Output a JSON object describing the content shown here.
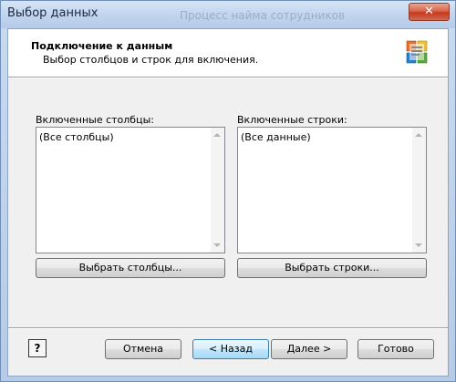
{
  "window": {
    "title": "Выбор данных",
    "background_title": "Процесс найма сотрудников",
    "close_glyph": "✕"
  },
  "header": {
    "title": "Подключение к данным",
    "subtitle": "Выбор столбцов и строк для включения.",
    "logo_icon": "office-logo-icon"
  },
  "columns": {
    "label": "Включенные столбцы:",
    "items": [
      "(Все столбцы)"
    ],
    "button": "Выбрать столбцы..."
  },
  "rows": {
    "label": "Включенные строки:",
    "items": [
      "(Все данные)"
    ],
    "button": "Выбрать строки..."
  },
  "footer": {
    "help_glyph": "?",
    "cancel": "Отмена",
    "back": "< Назад",
    "next": "Далее >",
    "finish": "Готово"
  },
  "colors": {
    "titlebar": "#c0d4ee",
    "close_button": "#c5381f",
    "dialog_bg": "#f0f0f0",
    "focus_border": "#3c7fb1"
  }
}
